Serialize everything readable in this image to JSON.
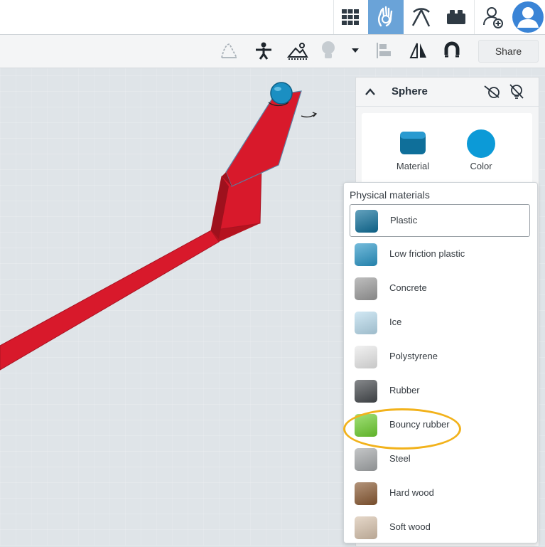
{
  "topbar": {
    "icons": [
      "grid-view-icon",
      "simulate-hand-icon",
      "pickaxe-icon",
      "brick-icon",
      "add-user-icon",
      "avatar-icon"
    ]
  },
  "toolbar": {
    "tools": [
      "shape-curve-icon",
      "simulation-actor-icon",
      "scene-light-icon",
      "lightbulb-icon",
      "dropdown-arrow-icon",
      "align-icon",
      "mirror-icon",
      "magnet-icon"
    ],
    "share_label": "Share"
  },
  "inspector": {
    "title": "Sphere",
    "material_label": "Material",
    "color_label": "Color",
    "color_value": "#0c9ad7"
  },
  "materials_menu": {
    "header": "Physical materials",
    "items": [
      {
        "label": "Plastic",
        "color": "#0f6f9a",
        "selected": true
      },
      {
        "label": "Low friction plastic",
        "color": "#2a97c8",
        "selected": false
      },
      {
        "label": "Concrete",
        "color": "#9c9c9c",
        "selected": false
      },
      {
        "label": "Ice",
        "color": "#b9dcee",
        "selected": false
      },
      {
        "label": "Polystyrene",
        "color": "#eaeaea",
        "selected": false
      },
      {
        "label": "Rubber",
        "color": "#45494d",
        "selected": false
      },
      {
        "label": "Bouncy rubber",
        "color": "#6fd030",
        "selected": false
      },
      {
        "label": "Steel",
        "color": "#a5a8aa",
        "selected": false
      },
      {
        "label": "Hard wood",
        "color": "#8a5a33",
        "selected": false
      },
      {
        "label": "Soft wood",
        "color": "#d8c3ad",
        "selected": false
      }
    ]
  },
  "scene": {
    "ramp_color": "#d8192b",
    "ball_color": "#1b8fc2"
  }
}
